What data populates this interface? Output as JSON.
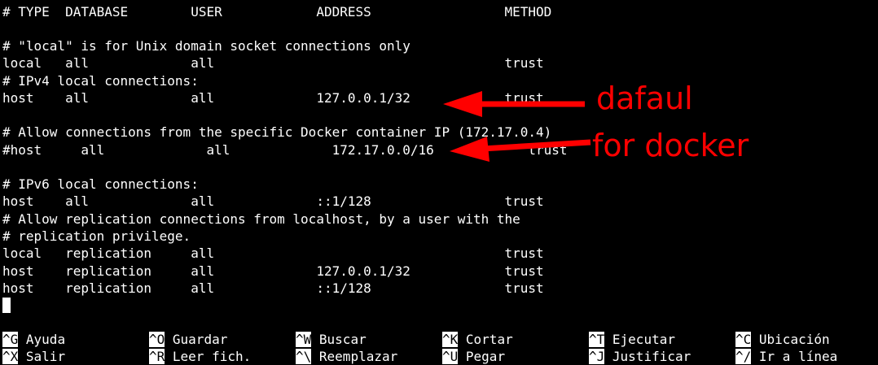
{
  "terminal": {
    "lines": [
      "# TYPE  DATABASE        USER            ADDRESS                 METHOD",
      "",
      "# \"local\" is for Unix domain socket connections only",
      "local   all             all                                     trust",
      "# IPv4 local connections:",
      "host    all             all             127.0.0.1/32            trust",
      "",
      "# Allow connections from the specific Docker container IP (172.17.0.4)",
      "#host     all             all             172.17.0.0/16            trust",
      "",
      "# IPv6 local connections:",
      "host    all             all             ::1/128                 trust",
      "# Allow replication connections from localhost, by a user with the",
      "# replication privilege.",
      "local   replication     all                                     trust",
      "host    replication     all             127.0.0.1/32            trust",
      "host    replication     all             ::1/128                 trust"
    ]
  },
  "shortcuts": {
    "row1": [
      {
        "key": "^G",
        "label": "Ayuda"
      },
      {
        "key": "^O",
        "label": "Guardar"
      },
      {
        "key": "^W",
        "label": "Buscar"
      },
      {
        "key": "^K",
        "label": "Cortar"
      },
      {
        "key": "^T",
        "label": "Ejecutar"
      },
      {
        "key": "^C",
        "label": "Ubicación"
      }
    ],
    "row2": [
      {
        "key": "^X",
        "label": "Salir"
      },
      {
        "key": "^R",
        "label": "Leer fich."
      },
      {
        "key": "^\\",
        "label": "Reemplazar"
      },
      {
        "key": "^U",
        "label": "Pegar"
      },
      {
        "key": "^J",
        "label": "Justificar"
      },
      {
        "key": "^/",
        "label": "Ir a línea"
      }
    ]
  },
  "annotations": {
    "default_label": "dafaul",
    "docker_label": "for docker",
    "color": "#ff0000"
  },
  "colors": {
    "background": "#000000",
    "text": "#ffffff",
    "annotation": "#ff0000"
  }
}
